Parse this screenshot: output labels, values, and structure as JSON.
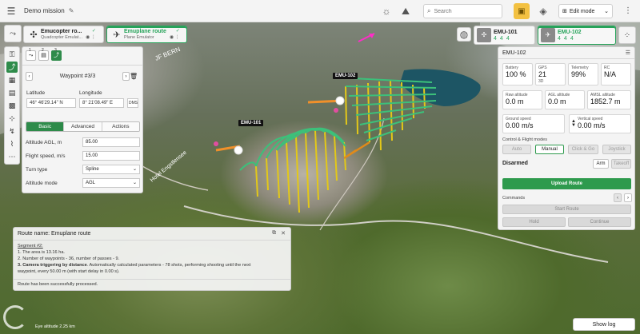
{
  "topbar": {
    "mission_title": "Demo mission",
    "search_placeholder": "Search",
    "mode_label": "Edit mode"
  },
  "vehicles": [
    {
      "name": "Emucopter ro...",
      "subtitle": "Quadcopter Emulat..."
    },
    {
      "name": "Emuplane route",
      "subtitle": "Plane Emulator"
    }
  ],
  "uavs": [
    {
      "name": "EMU-101",
      "counts": [
        "4",
        "4",
        "4"
      ]
    },
    {
      "name": "EMU-102",
      "counts": [
        "4",
        "4",
        "4"
      ]
    }
  ],
  "waypoint_panel": {
    "tab_numbers": [
      "1",
      "2",
      "3"
    ],
    "title": "Waypoint #3/3",
    "latitude_label": "Latitude",
    "longitude_label": "Longitude",
    "latitude": "46° 46'29.14\" N",
    "longitude": "8° 21'08.49\" E",
    "dms": "DMS",
    "tabs": [
      "Basic",
      "Advanced",
      "Actions"
    ],
    "fields": [
      {
        "label": "Altitude AGL, m",
        "value": "85.00"
      },
      {
        "label": "Flight speed, m/s",
        "value": "15.00"
      },
      {
        "label": "Turn type",
        "value": "Spline"
      },
      {
        "label": "Altitude mode",
        "value": "AGL"
      }
    ]
  },
  "route_panel": {
    "header": "Route name: Emuplane route",
    "segment": "Segment #2:",
    "line1": "1. The area is 13.16 ha.",
    "line2": "2. Number of waypoints - 36, number of passes - 9.",
    "line3a": "3. Camera triggering by distance",
    "line3b": ". Automatically calculated parameters - 78 shots, performing shooting until the next",
    "line3c": "waypoint, every 50.00 m (with start delay in 0.00 s).",
    "status": "Route has been successfully processed."
  },
  "telemetry": {
    "title": "EMU-102",
    "cards": [
      {
        "label": "Battery",
        "value": "100 %",
        "sub": ""
      },
      {
        "label": "GPS",
        "value": "21",
        "sub": "3D"
      },
      {
        "label": "Telemetry",
        "value": "99%",
        "sub": ""
      },
      {
        "label": "RC",
        "value": "N/A",
        "sub": ""
      }
    ],
    "alt_cards": [
      {
        "label": "Raw altitude",
        "value": "0.0 m"
      },
      {
        "label": "AGL altitude",
        "value": "0.0 m"
      },
      {
        "label": "AMSL altitude",
        "value": "1852.7 m"
      }
    ],
    "speed_cards": [
      {
        "label": "Ground speed",
        "value": "0.00 m/s"
      },
      {
        "label": "Vertical speed",
        "value": "0.00 m/s"
      }
    ],
    "control_label": "Control & Flight modes",
    "modes": [
      "Auto",
      "Manual",
      "Click & Go",
      "Joystick"
    ],
    "armed_state": "Disarmed",
    "arm_label": "Arm",
    "takeoff_label": "Takeoff",
    "upload_label": "Upload Route",
    "commands_label": "Commands",
    "start_label": "Start Route",
    "hold_label": "Hold",
    "continue_label": "Continue"
  },
  "map": {
    "label_emu101": "EMU-101",
    "label_emu102": "EMU-102",
    "place1": "JF BERN",
    "place2": "Hotel Engstlensee",
    "eye_altitude": "Eye altitude 2.25 km"
  },
  "show_log_label": "Show log",
  "colors": {
    "accent": "#2e9a4d",
    "mission_button": "#f3c141",
    "route_line": "#3cc07a",
    "route_vertical": "#e5c818"
  }
}
